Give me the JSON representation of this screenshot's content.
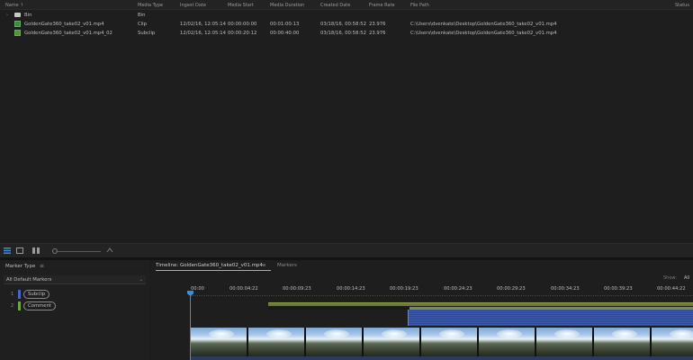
{
  "project": {
    "columns": {
      "name": "Name",
      "media_type": "Media Type",
      "ingest_date": "Ingest Date",
      "media_start": "Media Start",
      "media_duration": "Media Duration",
      "created_date": "Created Date",
      "frame_rate": "Frame Rate",
      "file_path": "File Path",
      "status": "Status"
    },
    "rows": [
      {
        "name": "Bin",
        "media_type": "Bin",
        "ingest_date": "",
        "media_start": "",
        "media_duration": "",
        "created_date": "",
        "frame_rate": "",
        "file_path": ""
      },
      {
        "name": "GoldenGate360_take02_v01.mp4",
        "media_type": "Clip",
        "ingest_date": "12/02/16, 12:05:14",
        "media_start": "00:00:00:00",
        "media_duration": "00:01:00:13",
        "created_date": "03/18/16, 00:58:52",
        "frame_rate": "23.976",
        "file_path": "C:\\Users\\dvenkate\\Desktop\\GoldenGate360_take02_v01.mp4"
      },
      {
        "name": "GoldenGate360_take02_v01.mp4_02",
        "media_type": "Subclip",
        "ingest_date": "12/02/16, 12:05:14",
        "media_start": "00:00:20:12",
        "media_duration": "00:00:40:00",
        "created_date": "03/18/16, 00:58:52",
        "frame_rate": "23.976",
        "file_path": "C:\\Users\\dvenkate\\Desktop\\GoldenGate360_take02_v01.mp4"
      }
    ]
  },
  "marker_panel": {
    "title": "Marker Type",
    "menu_glyph": "≡",
    "dropdown_value": "All Default Markers",
    "items": [
      {
        "num": "1",
        "label": "Subclip",
        "color": "#4a63c9"
      },
      {
        "num": "2",
        "label": "Comment",
        "color": "#6fa83a"
      }
    ]
  },
  "timeline": {
    "tab_label": "Timeline: GoldenGate360_take02_v01.mp4",
    "tab_menu": "≡",
    "markers_tab": "Markers",
    "show_label": "Show:",
    "show_value": "All",
    "ruler": [
      "00:00",
      "00:00:04:22",
      "00:00:09:23",
      "00:00:14:23",
      "00:00:19:23",
      "00:00:24:23",
      "00:00:29:23",
      "00:00:34:23",
      "00:00:39:23",
      "00:00:44:22"
    ],
    "colors": {
      "playhead": "#3b8ede",
      "subclip_track": "#3e5cab",
      "comment_track": "#6b7a3a"
    }
  }
}
